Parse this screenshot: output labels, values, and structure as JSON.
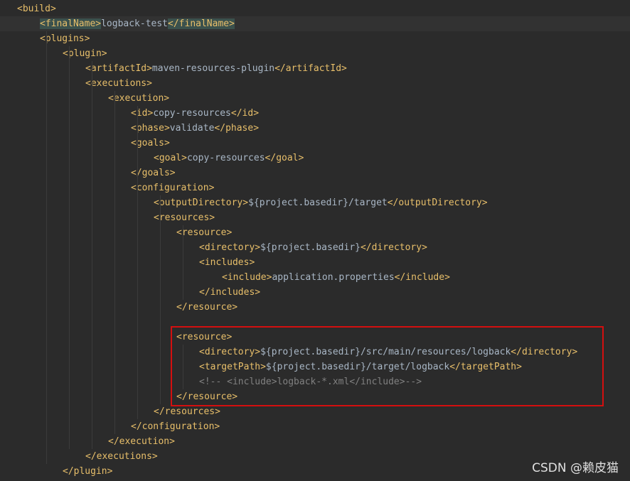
{
  "editor": {
    "lines": [
      {
        "segments": [
          {
            "t": "tag",
            "v": "<build>"
          }
        ]
      },
      {
        "segments": [
          {
            "t": "tag hl",
            "v": "<finalName>"
          },
          {
            "t": "text",
            "v": "logback-test"
          },
          {
            "t": "tag hl",
            "v": "</finalName>"
          }
        ],
        "current": true
      },
      {
        "segments": [
          {
            "t": "tag",
            "v": "<plugins>"
          }
        ]
      },
      {
        "segments": [
          {
            "t": "tag",
            "v": "<plugin>"
          }
        ]
      },
      {
        "segments": [
          {
            "t": "tag",
            "v": "<artifactId>"
          },
          {
            "t": "text",
            "v": "maven-resources-plugin"
          },
          {
            "t": "tag",
            "v": "</artifactId>"
          }
        ]
      },
      {
        "segments": [
          {
            "t": "tag",
            "v": "<executions>"
          }
        ]
      },
      {
        "segments": [
          {
            "t": "tag",
            "v": "<execution>"
          }
        ]
      },
      {
        "segments": [
          {
            "t": "tag",
            "v": "<id>"
          },
          {
            "t": "text",
            "v": "copy-resources"
          },
          {
            "t": "tag",
            "v": "</id>"
          }
        ]
      },
      {
        "segments": [
          {
            "t": "tag",
            "v": "<phase>"
          },
          {
            "t": "text",
            "v": "validate"
          },
          {
            "t": "tag",
            "v": "</phase>"
          }
        ]
      },
      {
        "segments": [
          {
            "t": "tag",
            "v": "<goals>"
          }
        ]
      },
      {
        "segments": [
          {
            "t": "tag",
            "v": "<goal>"
          },
          {
            "t": "text",
            "v": "copy-resources"
          },
          {
            "t": "tag",
            "v": "</goal>"
          }
        ]
      },
      {
        "segments": [
          {
            "t": "tag",
            "v": "</goals>"
          }
        ]
      },
      {
        "segments": [
          {
            "t": "tag",
            "v": "<configuration>"
          }
        ]
      },
      {
        "segments": [
          {
            "t": "tag",
            "v": "<outputDirectory>"
          },
          {
            "t": "text",
            "v": "${project.basedir}/target"
          },
          {
            "t": "tag",
            "v": "</outputDirectory>"
          }
        ]
      },
      {
        "segments": [
          {
            "t": "tag",
            "v": "<resources>"
          }
        ]
      },
      {
        "segments": [
          {
            "t": "tag",
            "v": "<resource>"
          }
        ]
      },
      {
        "segments": [
          {
            "t": "tag",
            "v": "<directory>"
          },
          {
            "t": "text",
            "v": "${project.basedir}"
          },
          {
            "t": "tag",
            "v": "</directory>"
          }
        ]
      },
      {
        "segments": [
          {
            "t": "tag",
            "v": "<includes>"
          }
        ]
      },
      {
        "segments": [
          {
            "t": "tag",
            "v": "<include>"
          },
          {
            "t": "text",
            "v": "application.properties"
          },
          {
            "t": "tag",
            "v": "</include>"
          }
        ]
      },
      {
        "segments": [
          {
            "t": "tag",
            "v": "</includes>"
          }
        ]
      },
      {
        "segments": [
          {
            "t": "tag",
            "v": "</resource>"
          }
        ]
      },
      {
        "segments": []
      },
      {
        "segments": [
          {
            "t": "tag",
            "v": "<resource>"
          }
        ]
      },
      {
        "segments": [
          {
            "t": "tag",
            "v": "<directory>"
          },
          {
            "t": "text",
            "v": "${project.basedir}/src/main/resources/logback"
          },
          {
            "t": "tag",
            "v": "</directory>"
          }
        ]
      },
      {
        "segments": [
          {
            "t": "tag",
            "v": "<targetPath>"
          },
          {
            "t": "text",
            "v": "${project.basedir}/target/logback"
          },
          {
            "t": "tag",
            "v": "</targetPath>"
          }
        ]
      },
      {
        "segments": [
          {
            "t": "comment",
            "v": "<!-- <include>logback-*.xml</include>-->"
          }
        ]
      },
      {
        "segments": [
          {
            "t": "tag",
            "v": "</resource>"
          }
        ]
      },
      {
        "segments": [
          {
            "t": "tag",
            "v": "</resources>"
          }
        ]
      },
      {
        "segments": [
          {
            "t": "tag",
            "v": "</configuration>"
          }
        ]
      },
      {
        "segments": [
          {
            "t": "tag",
            "v": "</execution>"
          }
        ]
      },
      {
        "segments": [
          {
            "t": "tag",
            "v": "</executions>"
          }
        ]
      },
      {
        "segments": [
          {
            "t": "tag",
            "v": "</plugin>"
          }
        ]
      }
    ]
  },
  "colors": {
    "background": "#2b2b2b",
    "tag": "#e8bf6a",
    "text": "#a9b7c6",
    "comment": "#808080",
    "highlight_box": "#d40f0f"
  },
  "watermark": "CSDN @赖皮猫"
}
